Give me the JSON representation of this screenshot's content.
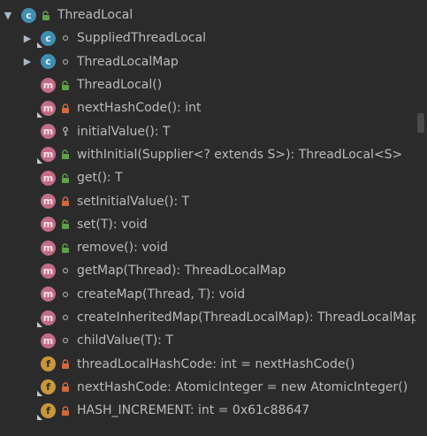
{
  "colors": {
    "background": "#2b2b2b",
    "text": "#bbbbbb",
    "class_badge": "#3e8fb0",
    "method_badge": "#c36c85",
    "field_badge": "#c9973a",
    "public_lock": "#5fa14a",
    "private_lock": "#d2683b"
  },
  "tree": {
    "root": {
      "label": "ThreadLocal",
      "icon": "class-icon",
      "visibility": "public"
    },
    "items": [
      {
        "label": "SuppliedThreadLocal",
        "icon": "class-icon",
        "visibility": "package",
        "expandable": true
      },
      {
        "label": "ThreadLocalMap",
        "icon": "class-icon",
        "visibility": "package",
        "expandable": true
      },
      {
        "label": "ThreadLocal()",
        "icon": "method-icon",
        "visibility": "public"
      },
      {
        "label": "nextHashCode(): int",
        "icon": "method-icon",
        "visibility": "private"
      },
      {
        "label": "initialValue(): T",
        "icon": "method-icon",
        "visibility": "protected"
      },
      {
        "label": "withInitial(Supplier<? extends S>): ThreadLocal<S>",
        "icon": "method-icon",
        "visibility": "public"
      },
      {
        "label": "get(): T",
        "icon": "method-icon",
        "visibility": "public"
      },
      {
        "label": "setInitialValue(): T",
        "icon": "method-icon",
        "visibility": "private"
      },
      {
        "label": "set(T): void",
        "icon": "method-icon",
        "visibility": "public"
      },
      {
        "label": "remove(): void",
        "icon": "method-icon",
        "visibility": "public"
      },
      {
        "label": "getMap(Thread): ThreadLocalMap",
        "icon": "method-icon",
        "visibility": "package"
      },
      {
        "label": "createMap(Thread, T): void",
        "icon": "method-icon",
        "visibility": "package"
      },
      {
        "label": "createInheritedMap(ThreadLocalMap): ThreadLocalMap",
        "icon": "method-icon",
        "visibility": "package"
      },
      {
        "label": "childValue(T): T",
        "icon": "method-icon",
        "visibility": "package"
      },
      {
        "label": "threadLocalHashCode: int = nextHashCode()",
        "icon": "field-icon",
        "visibility": "private"
      },
      {
        "label": "nextHashCode: AtomicInteger = new AtomicInteger()",
        "icon": "field-icon",
        "visibility": "private"
      },
      {
        "label": "HASH_INCREMENT: int = 0x61c88647",
        "icon": "field-icon",
        "visibility": "private"
      }
    ]
  }
}
